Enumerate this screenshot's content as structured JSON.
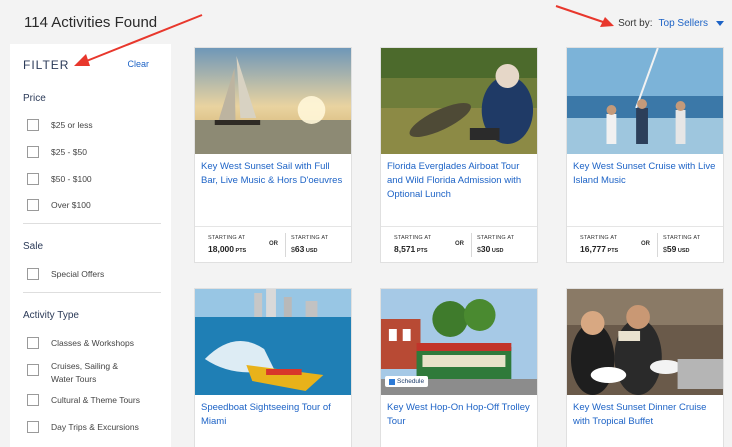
{
  "header": {
    "results_count": "114 Activities Found",
    "sort_label": "Sort by:",
    "sort_value": "Top Sellers"
  },
  "sidebar": {
    "filter_title": "FILTER",
    "clear_label": "Clear",
    "price": {
      "title": "Price",
      "options": [
        "$25 or less",
        "$25 - $50",
        "$50 - $100",
        "Over $100"
      ]
    },
    "sale": {
      "title": "Sale",
      "options": [
        "Special Offers"
      ]
    },
    "activity_type": {
      "title": "Activity Type",
      "options": [
        "Classes & Workshops",
        "Cruises, Sailing & Water Tours",
        "Cultural & Theme Tours",
        "Day Trips & Excursions"
      ]
    }
  },
  "cards": [
    {
      "title": "Key West Sunset Sail with Full Bar, Live Music & Hors D'oeuvres",
      "pts_label": "STARTING AT",
      "pts": "18,000",
      "pts_unit": "PTS",
      "or": "OR",
      "usd_label": "STARTING AT",
      "usd_symbol": "$",
      "usd": "63",
      "usd_unit": "USD"
    },
    {
      "title": "Florida Everglades Airboat Tour and Wild Florida Admission with Optional Lunch",
      "pts_label": "STARTING AT",
      "pts": "8,571",
      "pts_unit": "PTS",
      "or": "OR",
      "usd_label": "STARTING AT",
      "usd_symbol": "$",
      "usd": "30",
      "usd_unit": "USD"
    },
    {
      "title": "Key West Sunset Cruise with Live Island Music",
      "pts_label": "STARTING AT",
      "pts": "16,777",
      "pts_unit": "PTS",
      "or": "OR",
      "usd_label": "STARTING AT",
      "usd_symbol": "$",
      "usd": "59",
      "usd_unit": "USD"
    },
    {
      "title": "Speedboat Sightseeing Tour of Miami"
    },
    {
      "title": "Key West Hop-On Hop-Off Trolley Tour",
      "badge": "Schedule"
    },
    {
      "title": "Key West Sunset Dinner Cruise with Tropical Buffet"
    }
  ],
  "colors": {
    "link": "#1d63c6",
    "annotation_arrow": "#e8372c",
    "page_bg": "#f3f3f3"
  }
}
